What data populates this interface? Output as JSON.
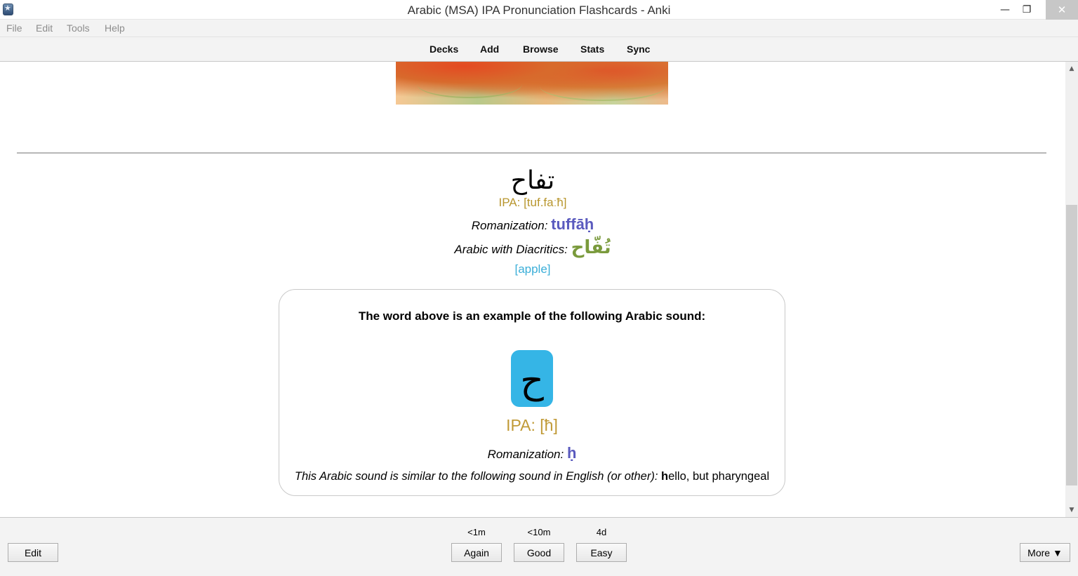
{
  "window": {
    "title": "Arabic (MSA) IPA Pronunciation Flashcards - Anki",
    "minimize": "—",
    "restore": "❐",
    "close": "✕"
  },
  "menu": [
    "File",
    "Edit",
    "Tools",
    "Help"
  ],
  "toolbar": [
    "Decks",
    "Add",
    "Browse",
    "Stats",
    "Sync"
  ],
  "card": {
    "word": "تفاح",
    "ipa": "IPA: [tuf.faːħ]",
    "romanization_label": "Romanization:",
    "romanization_value": "tuffāḥ",
    "diacritics_label": "Arabic with Diacritics:",
    "diacritics_value": "تُفّاح",
    "meaning": "[apple]",
    "sound_box": {
      "heading": "The word above is an example of the following Arabic sound:",
      "letter": "ح",
      "ipa": "IPA: [ħ]",
      "romanization_label": "Romanization:",
      "romanization_value": "ḥ",
      "similar_label": "This Arabic sound is similar to the following sound in English (or other):",
      "similar_bold": "h",
      "similar_rest": "ello, but pharyngeal"
    }
  },
  "answer_buttons": [
    {
      "interval": "<1m",
      "label": "Again"
    },
    {
      "interval": "<10m",
      "label": "Good"
    },
    {
      "interval": "4d",
      "label": "Easy"
    }
  ],
  "edit_button": "Edit",
  "more_button": "More ▼",
  "colors": {
    "ipa": "#b8962e",
    "romanization": "#5a5abe",
    "diacritics": "#7a9a3c",
    "meaning": "#3aaed8",
    "letter_tile": "#35b5e6"
  }
}
